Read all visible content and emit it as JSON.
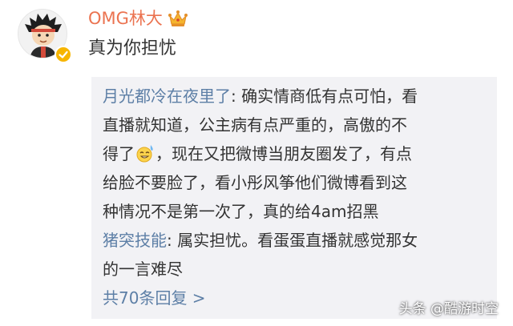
{
  "post": {
    "username": "OMG林大",
    "text": "真为你担忧"
  },
  "replies": [
    {
      "user": "月光都冷在夜里了",
      "before_emoji": ": 确实情商低有点可怕，看\n直播就知道，公主病有点严重的，高傲的不\n得了",
      "after_emoji": "，现在又把微博当朋友圈发了，有点\n给脸不要脸了，看小彤风筝他们微博看到这\n种情况不是第一次了，真的给4am招黑"
    },
    {
      "user": "猪突技能",
      "text": ": 属实担忧。看蛋蛋直播就感觉那女\n的一言难尽"
    }
  ],
  "view_all": "共70条回复 >",
  "watermark": "头条 @酷游时空",
  "icons": {
    "crown": "crown-icon",
    "verified": "verified-badge-icon",
    "emoji": "sweat-smile-emoji-icon"
  },
  "colors": {
    "username": "#eb7350",
    "reply_user": "#5d7fa6",
    "reply_bg": "#f2f2f5",
    "badge": "#f7b500"
  }
}
